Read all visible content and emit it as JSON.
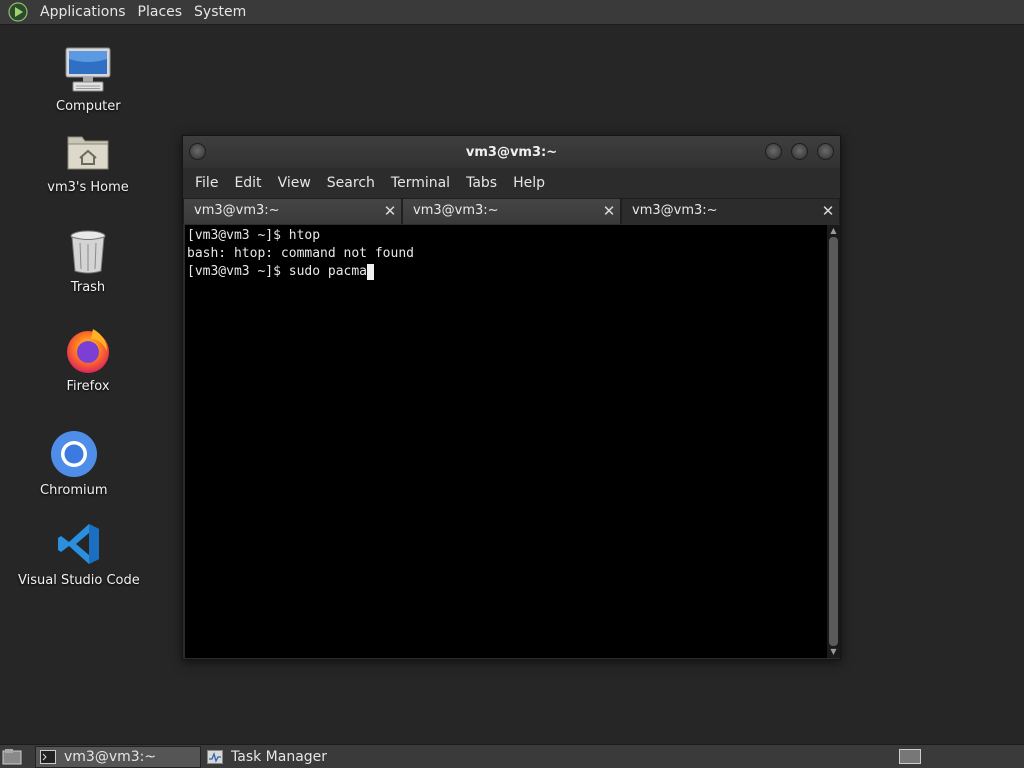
{
  "top_panel": {
    "menus": [
      "Applications",
      "Places",
      "System"
    ]
  },
  "desktop": {
    "icons": [
      {
        "label": "Computer",
        "icon": "computer-icon"
      },
      {
        "label": "vm3's Home",
        "icon": "home-folder-icon"
      },
      {
        "label": "Trash",
        "icon": "trash-icon"
      },
      {
        "label": "Firefox",
        "icon": "firefox-icon"
      },
      {
        "label": "Chromium",
        "icon": "chromium-icon"
      },
      {
        "label": "Visual Studio Code",
        "icon": "vscode-icon"
      }
    ]
  },
  "terminal": {
    "title": "vm3@vm3:~",
    "menu": [
      "File",
      "Edit",
      "View",
      "Search",
      "Terminal",
      "Tabs",
      "Help"
    ],
    "tabs": [
      {
        "label": "vm3@vm3:~",
        "active": false
      },
      {
        "label": "vm3@vm3:~",
        "active": false
      },
      {
        "label": "vm3@vm3:~",
        "active": true
      }
    ],
    "lines": [
      "[vm3@vm3 ~]$ htop",
      "bash: htop: command not found",
      "[vm3@vm3 ~]$ sudo pacma"
    ]
  },
  "taskbar": {
    "tasks": [
      {
        "label": "vm3@vm3:~",
        "active": true
      },
      {
        "label": "Task Manager",
        "active": false
      }
    ]
  },
  "colors": {
    "desktop_bg": "#262626",
    "panel_bg": "#3a3a3a",
    "terminal_bg": "#000000"
  }
}
